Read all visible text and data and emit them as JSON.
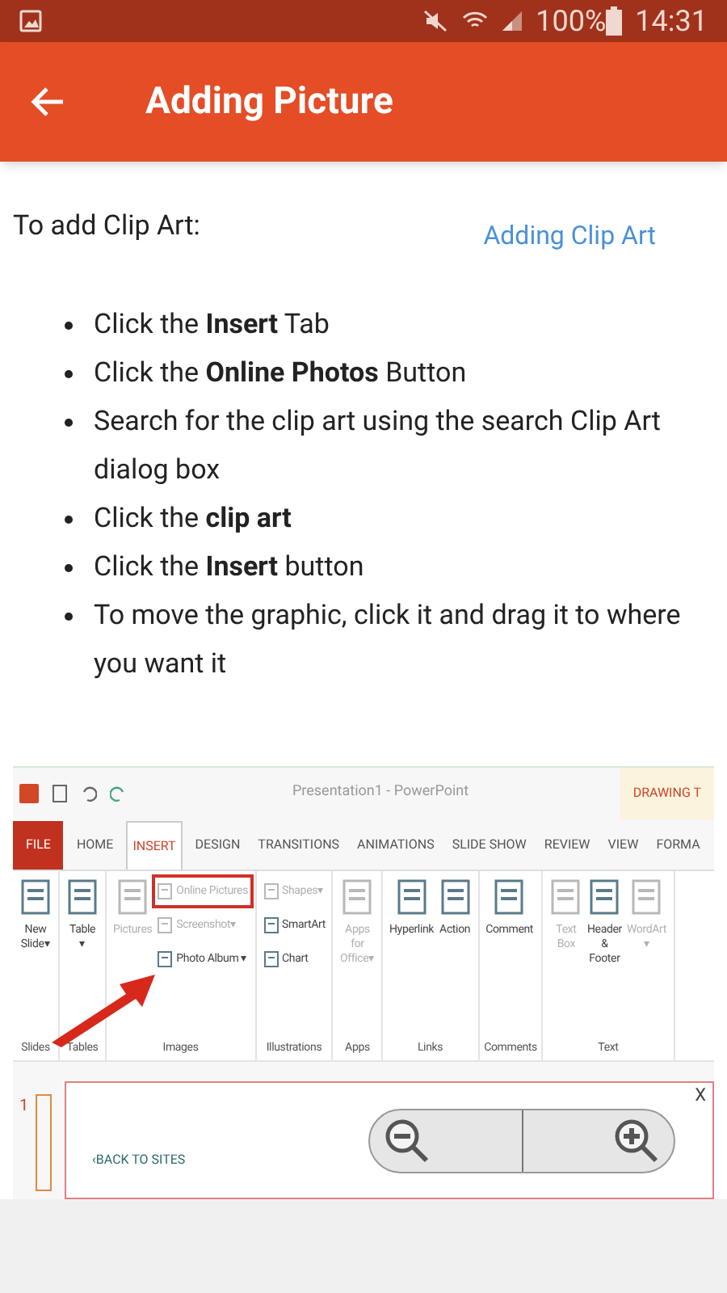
{
  "status_bar": {
    "battery": "100%",
    "time": "14:31"
  },
  "app_bar": {
    "title": "Adding Picture"
  },
  "intro": "To add Clip Art:",
  "link": "Adding Clip Art",
  "steps": [
    "Click the **Insert** Tab",
    "Click the **Online Photos** Button",
    "Search for the clip art using the search Clip Art dialog box",
    "Click the **clip art**",
    "Click the **Insert** button",
    "To move the graphic, click it and drag it to where you want it"
  ],
  "screenshot": {
    "title": "Presentation1 - PowerPoint",
    "contextual_tab": "DRAWING T",
    "tabs": [
      {
        "label": "FILE",
        "kind": "file",
        "selected": false
      },
      {
        "label": "HOME",
        "kind": "tab",
        "selected": false
      },
      {
        "label": "INSERT",
        "kind": "tab",
        "selected": true
      },
      {
        "label": "DESIGN",
        "kind": "tab",
        "selected": false
      },
      {
        "label": "TRANSITIONS",
        "kind": "tab",
        "selected": false
      },
      {
        "label": "ANIMATIONS",
        "kind": "tab",
        "selected": false
      },
      {
        "label": "SLIDE SHOW",
        "kind": "tab",
        "selected": false
      },
      {
        "label": "REVIEW",
        "kind": "tab",
        "selected": false
      },
      {
        "label": "VIEW",
        "kind": "tab",
        "selected": false
      },
      {
        "label": "FORMA",
        "kind": "tab",
        "selected": false
      }
    ],
    "groups": [
      {
        "label": "Slides",
        "items": [
          {
            "label": "New Slide▾",
            "kind": "large",
            "disabled": false,
            "highlighted": false
          }
        ]
      },
      {
        "label": "Tables",
        "items": [
          {
            "label": "Table ▾",
            "kind": "large",
            "disabled": false,
            "highlighted": false
          }
        ]
      },
      {
        "label": "Images",
        "items": [
          {
            "label": "Pictures",
            "kind": "large",
            "disabled": true,
            "highlighted": false
          },
          {
            "label": "Online Pictures",
            "kind": "small",
            "disabled": true,
            "highlighted": true
          },
          {
            "label": "Screenshot▾",
            "kind": "small",
            "disabled": true,
            "highlighted": false
          },
          {
            "label": "Photo Album ▾",
            "kind": "small",
            "disabled": false,
            "highlighted": false
          }
        ]
      },
      {
        "label": "Illustrations",
        "items": [
          {
            "label": "Shapes▾",
            "kind": "small",
            "disabled": true,
            "highlighted": false
          },
          {
            "label": "SmartArt",
            "kind": "small",
            "disabled": false,
            "highlighted": false
          },
          {
            "label": "Chart",
            "kind": "small",
            "disabled": false,
            "highlighted": false
          }
        ]
      },
      {
        "label": "Apps",
        "items": [
          {
            "label": "Apps for Office▾",
            "kind": "large",
            "disabled": true,
            "highlighted": false
          }
        ]
      },
      {
        "label": "Links",
        "items": [
          {
            "label": "Hyperlink",
            "kind": "large",
            "disabled": false,
            "highlighted": false
          },
          {
            "label": "Action",
            "kind": "large",
            "disabled": false,
            "highlighted": false
          }
        ]
      },
      {
        "label": "Comments",
        "items": [
          {
            "label": "Comment",
            "kind": "large",
            "disabled": false,
            "highlighted": false
          }
        ]
      },
      {
        "label": "Text",
        "items": [
          {
            "label": "Text Box",
            "kind": "large",
            "disabled": true,
            "highlighted": false
          },
          {
            "label": "Header & Footer",
            "kind": "large",
            "disabled": false,
            "highlighted": false
          },
          {
            "label": "WordArt ▾",
            "kind": "large",
            "disabled": true,
            "highlighted": false
          }
        ]
      }
    ],
    "slide_number": "1",
    "dialog": {
      "back": "‹BACK TO SITES",
      "close": "X"
    }
  }
}
